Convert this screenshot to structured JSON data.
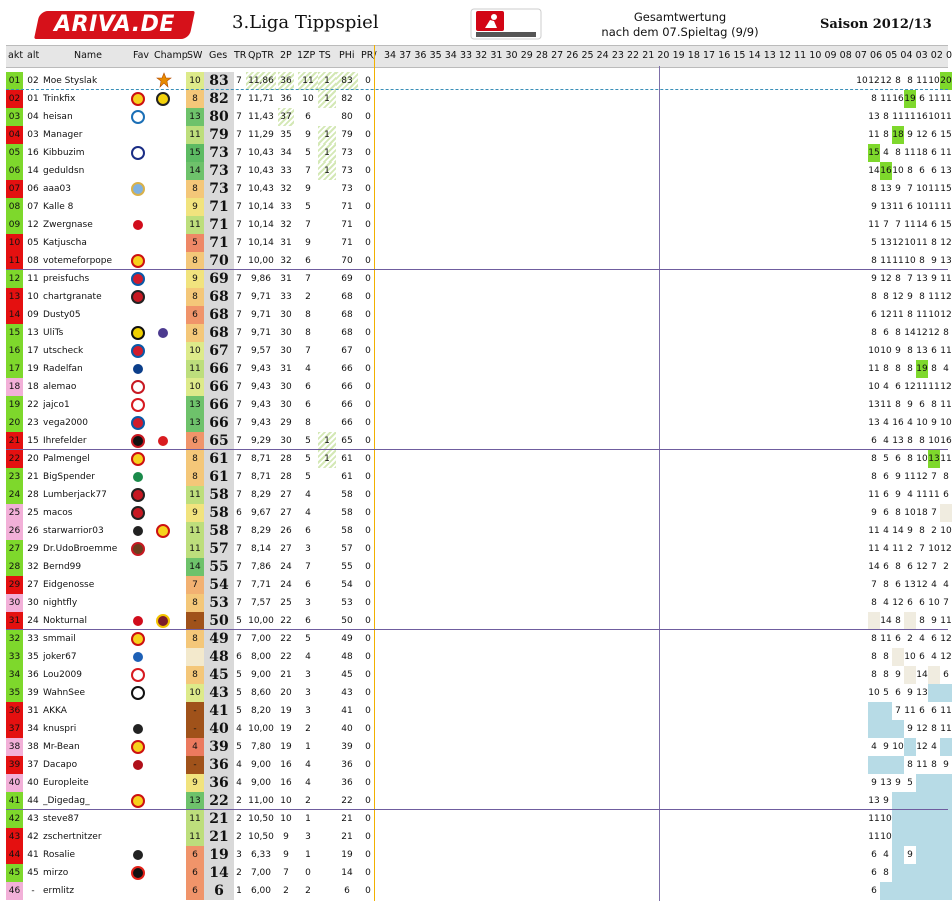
{
  "header": {
    "logo": "ARIVA.DE",
    "title": "3.Liga Tippspiel",
    "gesamt1": "Gesamtwertung",
    "gesamt2": "nach dem 07.Spieltag (9/9)",
    "saison": "Saison 2012/13",
    "bundesliga_logo": "bundesliga-logo"
  },
  "columns": {
    "akt": "akt",
    "alt": "alt",
    "name": "Name",
    "fav": "Fav",
    "champ": "Champ",
    "sw": "SW",
    "ges": "Ges",
    "tr": "TR",
    "qptr": "QpTR",
    "p2": "2P",
    "zp": "1ZP",
    "ts": "TS",
    "phi": "PHi",
    "pr": "PR/",
    "rounds": [
      "34",
      "37",
      "36",
      "35",
      "34",
      "33",
      "32",
      "31",
      "30",
      "29",
      "28",
      "27",
      "26",
      "25",
      "24",
      "23",
      "22",
      "21",
      "20",
      "19",
      "18",
      "17",
      "16",
      "15",
      "14",
      "13",
      "12",
      "11",
      "10",
      "09",
      "08",
      "07",
      "06",
      "05",
      "04",
      "03",
      "02",
      "01"
    ]
  },
  "round_labels": [
    "34",
    "37",
    "36",
    "35",
    "34",
    "33",
    "32",
    "31",
    "30",
    "29",
    "28",
    "27",
    "26",
    "25",
    "24",
    "23",
    "22",
    "21",
    "20",
    "19",
    "18",
    "17",
    "16",
    "15",
    "14",
    "13",
    "12",
    "11",
    "10",
    "09",
    "08",
    "07",
    "06",
    "05",
    "04",
    "03",
    "02",
    "01"
  ],
  "colors": {
    "rank_green": "#7ed82c",
    "rank_red": "#e41010",
    "rank_pink": "#f2b0d8",
    "header_gray": "#e6e6e6",
    "sep_purple": "#6f5d9f",
    "orange_line": "#f2b100",
    "highlight_green": "#7ed82c",
    "light_blue": "#b7dbe6"
  },
  "players": [
    {
      "akt": "01",
      "alt": "02",
      "name": "Moe Styslak",
      "fav": "",
      "champ": "star-icon",
      "sw": "10",
      "ges": "83",
      "tr": "7",
      "qptr": "11,86",
      "p2": "36",
      "zp": "11",
      "ts": "1",
      "phi": "83",
      "pr": "0",
      "r": [
        "10",
        "12",
        "12",
        "8",
        "8",
        "11",
        "10",
        "20"
      ]
    },
    {
      "akt": "02",
      "alt": "01",
      "name": "Trinkfix",
      "fav": "dynamo",
      "champ": "bvb",
      "sw": "8",
      "ges": "82",
      "tr": "7",
      "qptr": "11,71",
      "p2": "36",
      "zp": "10",
      "ts": "1",
      "phi": "82",
      "pr": "0",
      "r": [
        "8",
        "11",
        "16",
        "19",
        "6",
        "11",
        "11"
      ]
    },
    {
      "akt": "03",
      "alt": "04",
      "name": "heisan",
      "fav": "hansa",
      "champ": "",
      "sw": "13",
      "ges": "80",
      "tr": "7",
      "qptr": "11,43",
      "p2": "37",
      "zp": "6",
      "ts": "",
      "phi": "80",
      "pr": "0",
      "r": [
        "13",
        "8",
        "11",
        "11",
        "16",
        "10",
        "11"
      ]
    },
    {
      "akt": "04",
      "alt": "03",
      "name": "Manager",
      "fav": "",
      "champ": "",
      "sw": "11",
      "ges": "79",
      "tr": "7",
      "qptr": "11,29",
      "p2": "35",
      "zp": "9",
      "ts": "1",
      "phi": "79",
      "pr": "0",
      "r": [
        "11",
        "8",
        "18",
        "9",
        "12",
        "6",
        "15"
      ]
    },
    {
      "akt": "05",
      "alt": "16",
      "name": "Kibbuzim",
      "fav": "ksc",
      "champ": "",
      "sw": "15",
      "ges": "73",
      "tr": "7",
      "qptr": "10,43",
      "p2": "34",
      "zp": "5",
      "ts": "1",
      "phi": "73",
      "pr": "0",
      "r": [
        "15",
        "4",
        "8",
        "11",
        "18",
        "6",
        "11"
      ]
    },
    {
      "akt": "06",
      "alt": "14",
      "name": "geduldsn",
      "fav": "",
      "champ": "",
      "sw": "14",
      "ges": "73",
      "tr": "7",
      "qptr": "10,43",
      "p2": "33",
      "zp": "7",
      "ts": "1",
      "phi": "73",
      "pr": "0",
      "r": [
        "14",
        "16",
        "10",
        "8",
        "6",
        "6",
        "13"
      ]
    },
    {
      "akt": "07",
      "alt": "06",
      "name": "aaa03",
      "fav": "1860",
      "champ": "",
      "sw": "8",
      "ges": "73",
      "tr": "7",
      "qptr": "10,43",
      "p2": "32",
      "zp": "9",
      "ts": "",
      "phi": "73",
      "pr": "0",
      "r": [
        "8",
        "13",
        "9",
        "7",
        "10",
        "11",
        "15"
      ]
    },
    {
      "akt": "08",
      "alt": "07",
      "name": "Kalle 8",
      "fav": "",
      "champ": "",
      "sw": "9",
      "ges": "71",
      "tr": "7",
      "qptr": "10,14",
      "p2": "33",
      "zp": "5",
      "ts": "",
      "phi": "71",
      "pr": "0",
      "r": [
        "9",
        "13",
        "11",
        "6",
        "10",
        "11",
        "11"
      ]
    },
    {
      "akt": "09",
      "alt": "12",
      "name": "Zwergnase",
      "fav": "f95",
      "champ": "",
      "sw": "11",
      "ges": "71",
      "tr": "7",
      "qptr": "10,14",
      "p2": "32",
      "zp": "7",
      "ts": "",
      "phi": "71",
      "pr": "0",
      "r": [
        "11",
        "7",
        "7",
        "11",
        "14",
        "6",
        "15"
      ]
    },
    {
      "akt": "10",
      "alt": "05",
      "name": "Katjuscha",
      "fav": "",
      "champ": "",
      "sw": "5",
      "ges": "71",
      "tr": "7",
      "qptr": "10,14",
      "p2": "31",
      "zp": "9",
      "ts": "",
      "phi": "71",
      "pr": "0",
      "r": [
        "5",
        "13",
        "12",
        "10",
        "11",
        "8",
        "12"
      ]
    },
    {
      "akt": "11",
      "alt": "08",
      "name": "votemeforpope",
      "fav": "dynamo",
      "champ": "",
      "sw": "8",
      "ges": "70",
      "tr": "7",
      "qptr": "10,00",
      "p2": "32",
      "zp": "6",
      "ts": "",
      "phi": "70",
      "pr": "0",
      "r": [
        "8",
        "11",
        "11",
        "10",
        "8",
        "9",
        "13"
      ]
    },
    {
      "akt": "12",
      "alt": "11",
      "name": "preisfuchs",
      "fav": "bayern",
      "champ": "",
      "sw": "9",
      "ges": "69",
      "tr": "7",
      "qptr": "9,86",
      "p2": "31",
      "zp": "7",
      "ts": "",
      "phi": "69",
      "pr": "0",
      "r": [
        "9",
        "12",
        "8",
        "7",
        "13",
        "9",
        "11"
      ]
    },
    {
      "akt": "13",
      "alt": "10",
      "name": "chartgranate",
      "fav": "freiburg",
      "champ": "",
      "sw": "8",
      "ges": "68",
      "tr": "7",
      "qptr": "9,71",
      "p2": "33",
      "zp": "2",
      "ts": "",
      "phi": "68",
      "pr": "0",
      "r": [
        "8",
        "8",
        "12",
        "9",
        "8",
        "11",
        "12"
      ]
    },
    {
      "akt": "14",
      "alt": "09",
      "name": "Dusty05",
      "fav": "",
      "champ": "",
      "sw": "6",
      "ges": "68",
      "tr": "7",
      "qptr": "9,71",
      "p2": "30",
      "zp": "8",
      "ts": "",
      "phi": "68",
      "pr": "0",
      "r": [
        "6",
        "12",
        "11",
        "8",
        "11",
        "10",
        "12"
      ]
    },
    {
      "akt": "15",
      "alt": "13",
      "name": "UliTs",
      "fav": "aachen",
      "champ": "vfl",
      "sw": "8",
      "ges": "68",
      "tr": "7",
      "qptr": "9,71",
      "p2": "30",
      "zp": "8",
      "ts": "",
      "phi": "68",
      "pr": "0",
      "r": [
        "8",
        "6",
        "8",
        "14",
        "12",
        "12",
        "8"
      ]
    },
    {
      "akt": "16",
      "alt": "17",
      "name": "utscheck",
      "fav": "bayern",
      "champ": "",
      "sw": "10",
      "ges": "67",
      "tr": "7",
      "qptr": "9,57",
      "p2": "30",
      "zp": "7",
      "ts": "",
      "phi": "67",
      "pr": "0",
      "r": [
        "10",
        "10",
        "9",
        "8",
        "13",
        "6",
        "11"
      ]
    },
    {
      "akt": "17",
      "alt": "19",
      "name": "Radelfan",
      "fav": "hsv",
      "champ": "",
      "sw": "11",
      "ges": "66",
      "tr": "7",
      "qptr": "9,43",
      "p2": "31",
      "zp": "4",
      "ts": "",
      "phi": "66",
      "pr": "0",
      "r": [
        "11",
        "8",
        "8",
        "8",
        "19",
        "8",
        "4"
      ]
    },
    {
      "akt": "18",
      "alt": "18",
      "name": "alemao",
      "fav": "koeln",
      "champ": "",
      "sw": "10",
      "ges": "66",
      "tr": "7",
      "qptr": "9,43",
      "p2": "30",
      "zp": "6",
      "ts": "",
      "phi": "66",
      "pr": "0",
      "r": [
        "10",
        "4",
        "6",
        "12",
        "11",
        "11",
        "12"
      ]
    },
    {
      "akt": "19",
      "alt": "22",
      "name": "jajco1",
      "fav": "vfb",
      "champ": "",
      "sw": "13",
      "ges": "66",
      "tr": "7",
      "qptr": "9,43",
      "p2": "30",
      "zp": "6",
      "ts": "",
      "phi": "66",
      "pr": "0",
      "r": [
        "13",
        "11",
        "8",
        "9",
        "6",
        "8",
        "11"
      ]
    },
    {
      "akt": "20",
      "alt": "23",
      "name": "vega2000",
      "fav": "bayern",
      "champ": "",
      "sw": "13",
      "ges": "66",
      "tr": "7",
      "qptr": "9,43",
      "p2": "29",
      "zp": "8",
      "ts": "",
      "phi": "66",
      "pr": "0",
      "r": [
        "13",
        "4",
        "16",
        "4",
        "10",
        "9",
        "10"
      ]
    },
    {
      "akt": "21",
      "alt": "15",
      "name": "Ihrefelder",
      "fav": "eintracht",
      "champ": "offenbach",
      "sw": "6",
      "ges": "65",
      "tr": "7",
      "qptr": "9,29",
      "p2": "30",
      "zp": "5",
      "ts": "1",
      "phi": "65",
      "pr": "0",
      "r": [
        "6",
        "4",
        "13",
        "8",
        "8",
        "10",
        "16"
      ]
    },
    {
      "akt": "22",
      "alt": "20",
      "name": "Palmengel",
      "fav": "dynamo",
      "champ": "",
      "sw": "8",
      "ges": "61",
      "tr": "7",
      "qptr": "8,71",
      "p2": "28",
      "zp": "5",
      "ts": "1",
      "phi": "61",
      "pr": "0",
      "r": [
        "8",
        "5",
        "6",
        "8",
        "10",
        "13",
        "11"
      ]
    },
    {
      "akt": "23",
      "alt": "21",
      "name": "BigSpender",
      "fav": "werder",
      "champ": "",
      "sw": "8",
      "ges": "61",
      "tr": "7",
      "qptr": "8,71",
      "p2": "28",
      "zp": "5",
      "ts": "",
      "phi": "61",
      "pr": "0",
      "r": [
        "8",
        "6",
        "9",
        "11",
        "12",
        "7",
        "8"
      ]
    },
    {
      "akt": "24",
      "alt": "28",
      "name": "Lumberjack77",
      "fav": "freiburg",
      "champ": "",
      "sw": "11",
      "ges": "58",
      "tr": "7",
      "qptr": "8,29",
      "p2": "27",
      "zp": "4",
      "ts": "",
      "phi": "58",
      "pr": "0",
      "r": [
        "11",
        "6",
        "9",
        "4",
        "11",
        "11",
        "6"
      ]
    },
    {
      "akt": "25",
      "alt": "25",
      "name": "macos",
      "fav": "freiburg",
      "champ": "",
      "sw": "9",
      "ges": "58",
      "tr": "6",
      "qptr": "9,67",
      "p2": "27",
      "zp": "4",
      "ts": "",
      "phi": "58",
      "pr": "0",
      "r": [
        "9",
        "6",
        "8",
        "10",
        "18",
        "7",
        ""
      ]
    },
    {
      "akt": "26",
      "alt": "26",
      "name": "starwarrior03",
      "fav": "gladbach",
      "champ": "dynamo",
      "sw": "11",
      "ges": "58",
      "tr": "7",
      "qptr": "8,29",
      "p2": "26",
      "zp": "6",
      "ts": "",
      "phi": "58",
      "pr": "0",
      "r": [
        "11",
        "4",
        "14",
        "9",
        "8",
        "2",
        "10"
      ]
    },
    {
      "akt": "27",
      "alt": "29",
      "name": "Dr.UdoBroemme",
      "fav": "stpauli",
      "champ": "",
      "sw": "11",
      "ges": "57",
      "tr": "7",
      "qptr": "8,14",
      "p2": "27",
      "zp": "3",
      "ts": "",
      "phi": "57",
      "pr": "0",
      "r": [
        "11",
        "4",
        "11",
        "2",
        "7",
        "10",
        "12"
      ]
    },
    {
      "akt": "28",
      "alt": "32",
      "name": "Bernd99",
      "fav": "",
      "champ": "",
      "sw": "14",
      "ges": "55",
      "tr": "7",
      "qptr": "7,86",
      "p2": "24",
      "zp": "7",
      "ts": "",
      "phi": "55",
      "pr": "0",
      "r": [
        "14",
        "6",
        "8",
        "6",
        "12",
        "7",
        "2"
      ]
    },
    {
      "akt": "29",
      "alt": "27",
      "name": "Eidgenosse",
      "fav": "",
      "champ": "",
      "sw": "7",
      "ges": "54",
      "tr": "7",
      "qptr": "7,71",
      "p2": "24",
      "zp": "6",
      "ts": "",
      "phi": "54",
      "pr": "0",
      "r": [
        "7",
        "8",
        "6",
        "13",
        "12",
        "4",
        "4"
      ]
    },
    {
      "akt": "30",
      "alt": "30",
      "name": "nightfly",
      "fav": "",
      "champ": "",
      "sw": "8",
      "ges": "53",
      "tr": "7",
      "qptr": "7,57",
      "p2": "25",
      "zp": "3",
      "ts": "",
      "phi": "53",
      "pr": "0",
      "r": [
        "8",
        "4",
        "12",
        "6",
        "6",
        "10",
        "7"
      ]
    },
    {
      "akt": "31",
      "alt": "24",
      "name": "Nokturnal",
      "fav": "union",
      "champ": "aue",
      "sw": "-",
      "ges": "50",
      "tr": "5",
      "qptr": "10,00",
      "p2": "22",
      "zp": "6",
      "ts": "",
      "phi": "50",
      "pr": "0",
      "r": [
        "",
        "14",
        "8",
        "",
        "8",
        "9",
        "11"
      ]
    },
    {
      "akt": "32",
      "alt": "33",
      "name": "smmail",
      "fav": "dynamo",
      "champ": "",
      "sw": "8",
      "ges": "49",
      "tr": "7",
      "qptr": "7,00",
      "p2": "22",
      "zp": "5",
      "ts": "",
      "phi": "49",
      "pr": "0",
      "r": [
        "8",
        "11",
        "6",
        "2",
        "4",
        "6",
        "12"
      ]
    },
    {
      "akt": "33",
      "alt": "35",
      "name": "joker67",
      "fav": "schalke",
      "champ": "",
      "sw": "",
      "ges": "48",
      "tr": "6",
      "qptr": "8,00",
      "p2": "22",
      "zp": "4",
      "ts": "",
      "phi": "48",
      "pr": "0",
      "r": [
        "8",
        "8",
        "",
        "10",
        "6",
        "4",
        "12"
      ]
    },
    {
      "akt": "34",
      "alt": "36",
      "name": "Lou2009",
      "fav": "vfb",
      "champ": "",
      "sw": "8",
      "ges": "45",
      "tr": "5",
      "qptr": "9,00",
      "p2": "21",
      "zp": "3",
      "ts": "",
      "phi": "45",
      "pr": "0",
      "r": [
        "8",
        "8",
        "9",
        "",
        "14",
        "",
        "6"
      ]
    },
    {
      "akt": "35",
      "alt": "39",
      "name": "WahnSee",
      "fav": "eintracht_eagle",
      "champ": "",
      "sw": "10",
      "ges": "43",
      "tr": "5",
      "qptr": "8,60",
      "p2": "20",
      "zp": "3",
      "ts": "",
      "phi": "43",
      "pr": "0",
      "r": [
        "10",
        "5",
        "6",
        "9",
        "13",
        "",
        ""
      ]
    },
    {
      "akt": "36",
      "alt": "31",
      "name": "AKKA",
      "fav": "",
      "champ": "",
      "sw": "-",
      "ges": "41",
      "tr": "5",
      "qptr": "8,20",
      "p2": "19",
      "zp": "3",
      "ts": "",
      "phi": "41",
      "pr": "0",
      "r": [
        "",
        "",
        "7",
        "11",
        "6",
        "6",
        "11"
      ]
    },
    {
      "akt": "37",
      "alt": "34",
      "name": "knuspri",
      "fav": "gladbach",
      "champ": "",
      "sw": "-",
      "ges": "40",
      "tr": "4",
      "qptr": "10,00",
      "p2": "19",
      "zp": "2",
      "ts": "",
      "phi": "40",
      "pr": "0",
      "r": [
        "",
        "",
        "",
        "9",
        "12",
        "8",
        "11"
      ]
    },
    {
      "akt": "38",
      "alt": "38",
      "name": "Mr-Bean",
      "fav": "dynamo",
      "champ": "",
      "sw": "4",
      "ges": "39",
      "tr": "5",
      "qptr": "7,80",
      "p2": "19",
      "zp": "1",
      "ts": "",
      "phi": "39",
      "pr": "0",
      "r": [
        "4",
        "9",
        "10",
        "",
        "12",
        "4",
        ""
      ]
    },
    {
      "akt": "39",
      "alt": "37",
      "name": "Dacapo",
      "fav": "fcn",
      "champ": "",
      "sw": "-",
      "ges": "36",
      "tr": "4",
      "qptr": "9,00",
      "p2": "16",
      "zp": "4",
      "ts": "",
      "phi": "36",
      "pr": "0",
      "r": [
        "",
        "",
        "",
        "8",
        "11",
        "8",
        "9"
      ]
    },
    {
      "akt": "40",
      "alt": "40",
      "name": "Europleite",
      "fav": "",
      "champ": "",
      "sw": "9",
      "ges": "36",
      "tr": "4",
      "qptr": "9,00",
      "p2": "16",
      "zp": "4",
      "ts": "",
      "phi": "36",
      "pr": "0",
      "r": [
        "9",
        "13",
        "9",
        "5",
        "",
        "",
        ""
      ]
    },
    {
      "akt": "41",
      "alt": "44",
      "name": "_Digedag_",
      "fav": "dynamo",
      "champ": "",
      "sw": "13",
      "ges": "22",
      "tr": "2",
      "qptr": "11,00",
      "p2": "10",
      "zp": "2",
      "ts": "",
      "phi": "22",
      "pr": "0",
      "r": [
        "13",
        "9",
        "",
        "",
        "",
        "",
        ""
      ]
    },
    {
      "akt": "42",
      "alt": "43",
      "name": "steve87",
      "fav": "",
      "champ": "",
      "sw": "11",
      "ges": "21",
      "tr": "2",
      "qptr": "10,50",
      "p2": "10",
      "zp": "1",
      "ts": "",
      "phi": "21",
      "pr": "0",
      "r": [
        "11",
        "10",
        "",
        "",
        "",
        "",
        ""
      ]
    },
    {
      "akt": "43",
      "alt": "42",
      "name": "zschertnitzer",
      "fav": "",
      "champ": "",
      "sw": "11",
      "ges": "21",
      "tr": "2",
      "qptr": "10,50",
      "p2": "9",
      "zp": "3",
      "ts": "",
      "phi": "21",
      "pr": "0",
      "r": [
        "11",
        "10",
        "",
        "",
        "",
        "",
        ""
      ]
    },
    {
      "akt": "44",
      "alt": "41",
      "name": "Rosalie",
      "fav": "gladbach",
      "champ": "",
      "sw": "6",
      "ges": "19",
      "tr": "3",
      "qptr": "6,33",
      "p2": "9",
      "zp": "1",
      "ts": "",
      "phi": "19",
      "pr": "0",
      "r": [
        "6",
        "4",
        "",
        "9",
        "",
        "",
        ""
      ]
    },
    {
      "akt": "45",
      "alt": "45",
      "name": "mirzo",
      "fav": "leverkusen",
      "champ": "",
      "sw": "6",
      "ges": "14",
      "tr": "2",
      "qptr": "7,00",
      "p2": "7",
      "zp": "0",
      "ts": "",
      "phi": "14",
      "pr": "0",
      "r": [
        "6",
        "8",
        "",
        "",
        "",
        "",
        ""
      ]
    },
    {
      "akt": "46",
      "alt": "-",
      "name": "ermlitz",
      "fav": "",
      "champ": "",
      "sw": "6",
      "ges": "6",
      "tr": "1",
      "qptr": "6,00",
      "p2": "2",
      "zp": "2",
      "ts": "",
      "phi": "6",
      "pr": "0",
      "r": [
        "6",
        "",
        "",
        "",
        "",
        "",
        ""
      ]
    }
  ]
}
